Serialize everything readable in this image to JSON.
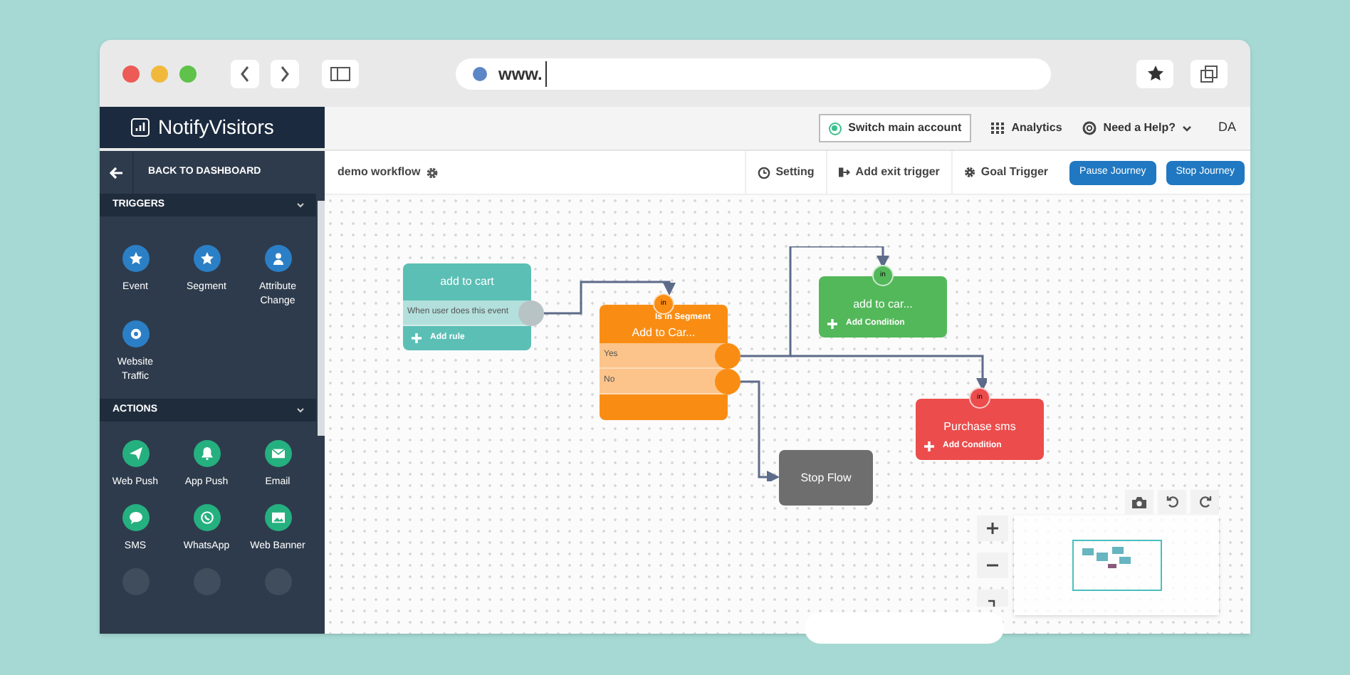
{
  "browser": {
    "url": "www."
  },
  "header": {
    "logo": "NotifyVisitors",
    "switch_account": "Switch main account",
    "analytics": "Analytics",
    "help": "Need a Help?",
    "user": "DA"
  },
  "sidebar": {
    "back": "BACK TO DASHBOARD",
    "sections": [
      {
        "title": "TRIGGERS",
        "kind": "trigger",
        "expanded": true,
        "items": [
          {
            "label": "Event"
          },
          {
            "label": "Segment"
          },
          {
            "label": "Attribute Change"
          },
          {
            "label": "Website Traffic"
          }
        ]
      },
      {
        "title": "ACTIONS",
        "kind": "action",
        "expanded": true,
        "items": [
          {
            "label": "Web Push"
          },
          {
            "label": "App Push"
          },
          {
            "label": "Email"
          },
          {
            "label": "SMS"
          },
          {
            "label": "WhatsApp"
          },
          {
            "label": "Web Banner"
          },
          {
            "faded": true
          },
          {
            "faded": true
          },
          {
            "faded": true
          }
        ]
      }
    ]
  },
  "toolbar": {
    "workflow_name": "demo workflow",
    "buttons": [
      {
        "label": "Setting",
        "kind": "plain"
      },
      {
        "label": "Add exit trigger",
        "kind": "plain"
      },
      {
        "label": "Goal Trigger",
        "kind": "plain"
      },
      {
        "label": "Pause Journey",
        "kind": "primary"
      },
      {
        "label": "Stop Journey",
        "kind": "primary"
      }
    ]
  },
  "nodes": [
    {
      "kind": "event",
      "color": "#5bbfb5",
      "title": "add to cart",
      "rows": [
        "When user does this event"
      ],
      "footer": "Add rule"
    },
    {
      "kind": "segment",
      "color": "#f98d14",
      "badge": "in",
      "subtitle": "Is in Segment",
      "title": "Add to Car...",
      "rows": [
        "Yes",
        "No"
      ]
    },
    {
      "kind": "action",
      "color": "#53b85a",
      "badge": "in",
      "title": "add to car...",
      "footer": "Add Condition"
    },
    {
      "kind": "action",
      "color": "#ec4c4c",
      "badge": "in",
      "title": "Purchase sms",
      "footer": "Add Condition"
    },
    {
      "kind": "stop",
      "color": "#6e6e6e",
      "title": "Stop Flow"
    }
  ]
}
